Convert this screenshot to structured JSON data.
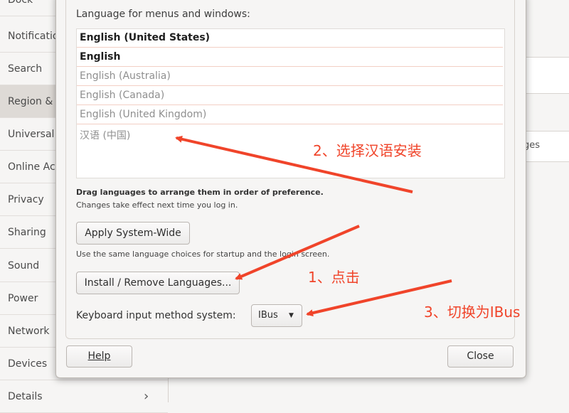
{
  "sidebar": {
    "items": [
      {
        "label": "Dock"
      },
      {
        "label": "Notifications"
      },
      {
        "label": "Search"
      },
      {
        "label": "Region & Language"
      },
      {
        "label": "Universal Access"
      },
      {
        "label": "Online Accounts"
      },
      {
        "label": "Privacy"
      },
      {
        "label": "Sharing"
      },
      {
        "label": "Sound"
      },
      {
        "label": "Power"
      },
      {
        "label": "Network"
      },
      {
        "label": "Devices"
      },
      {
        "label": "Details"
      }
    ],
    "details_chevron": "›"
  },
  "pane": {
    "partial_text": "ges"
  },
  "dialog": {
    "list_label": "Language for menus and windows:",
    "languages": [
      {
        "label": "English (United States)",
        "state": "active"
      },
      {
        "label": "English",
        "state": "active"
      },
      {
        "label": "English (Australia)",
        "state": "inactive"
      },
      {
        "label": "English (Canada)",
        "state": "inactive"
      },
      {
        "label": "English (United Kingdom)",
        "state": "inactive"
      },
      {
        "label": "汉语 (中国)",
        "state": "inactive"
      }
    ],
    "drag_hint": "Drag languages to arrange them in order of preference.",
    "effect_hint": "Changes take effect next time you log in.",
    "apply_button": "Apply System-Wide",
    "apply_hint": "Use the same language choices for startup and the login screen.",
    "install_button": "Install / Remove Languages...",
    "keyboard_label": "Keyboard input method system:",
    "keyboard_value": "IBus",
    "help_button": "Help",
    "close_button": "Close"
  },
  "annotations": {
    "step1": "1、点击",
    "step2": "2、选择汉语安装",
    "step3": "3、切换为IBus",
    "color": "#f0442a"
  }
}
